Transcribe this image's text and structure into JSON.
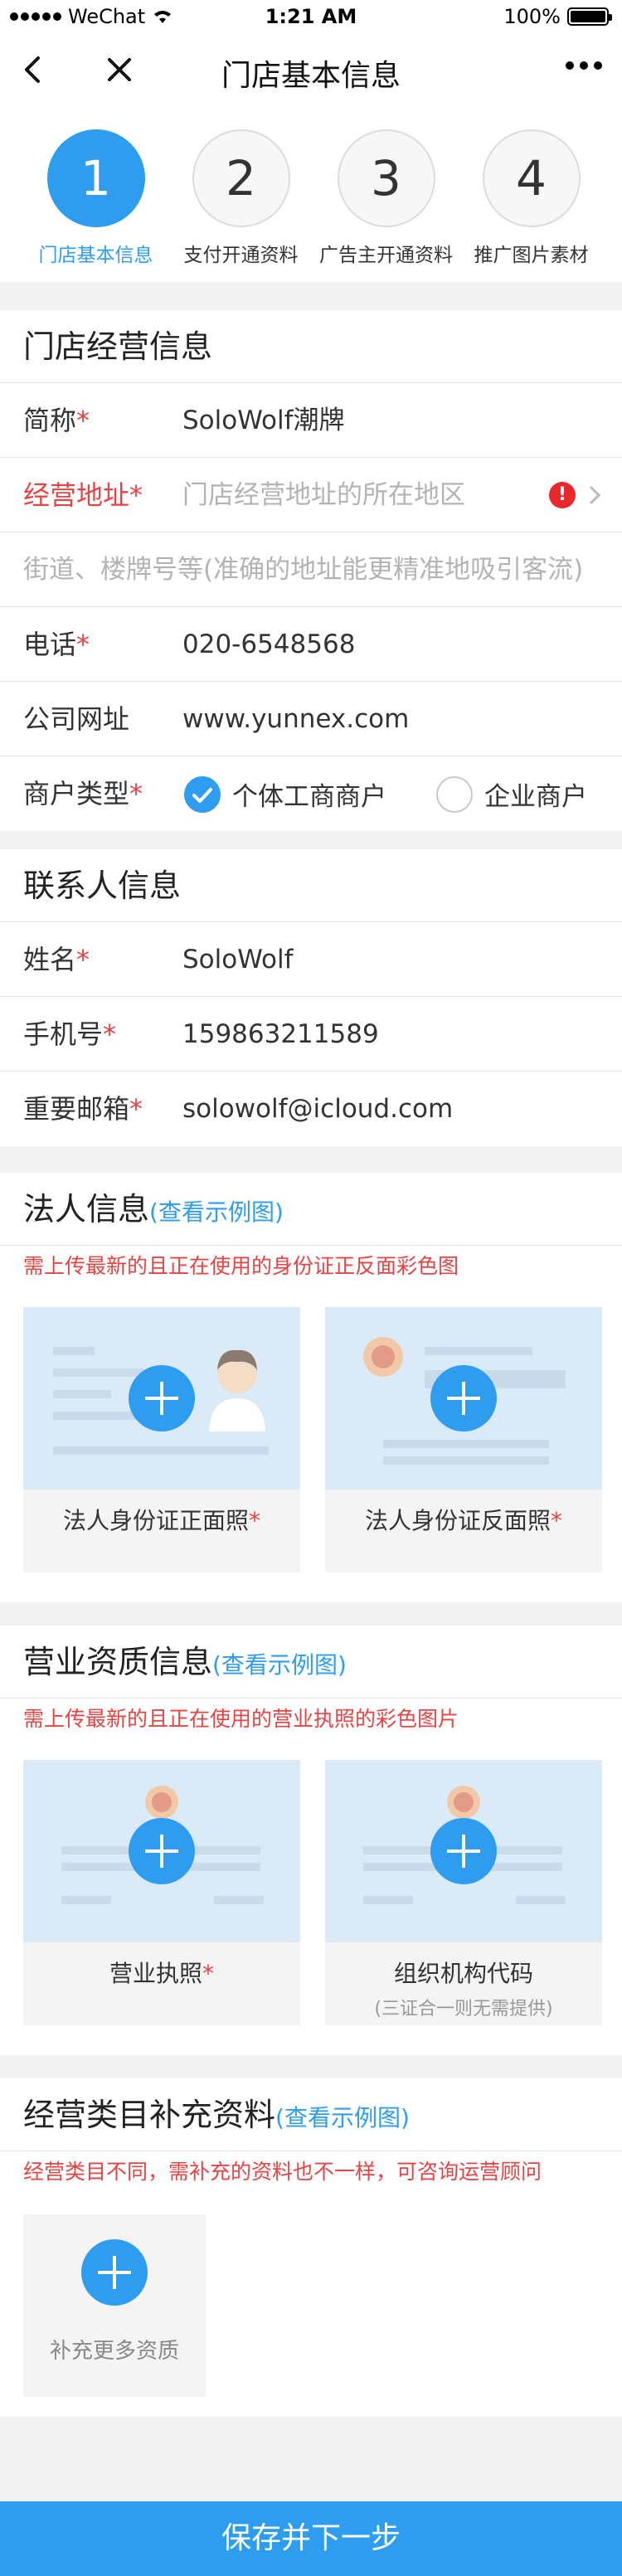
{
  "status_bar": {
    "carrier": "WeChat",
    "time": "1:21 AM",
    "battery": "100%"
  },
  "nav": {
    "title": "门店基本信息"
  },
  "steps": [
    {
      "num": "1",
      "label": "门店基本信息"
    },
    {
      "num": "2",
      "label": "支付开通资料"
    },
    {
      "num": "3",
      "label": "广告主开通资料"
    },
    {
      "num": "4",
      "label": "推广图片素材"
    }
  ],
  "store": {
    "header": "门店经营信息",
    "short_name_label": "简称",
    "short_name_value": "SoloWolf潮牌",
    "address_label": "经营地址",
    "address_placeholder": "门店经营地址的所在地区",
    "address_error_mark": "!",
    "street_placeholder": "街道、楼牌号等(准确的地址能更精准地吸引客流)",
    "phone_label": "电话",
    "phone_value": "020-6548568",
    "website_label": "公司网址",
    "website_value": "www.yunnex.com",
    "merchant_type_label": "商户类型",
    "merchant_type_option1": "个体工商商户",
    "merchant_type_option2": "企业商户"
  },
  "contact": {
    "header": "联系人信息",
    "name_label": "姓名",
    "name_value": "SoloWolf",
    "mobile_label": "手机号",
    "mobile_value": "159863211589",
    "email_label": "重要邮箱",
    "email_value": "solowolf@icloud.com"
  },
  "legal": {
    "header": "法人信息",
    "example_link": "(查看示例图)",
    "hint": "需上传最新的且正在使用的身份证正反面彩色图",
    "front_label": "法人身份证正面照",
    "back_label": "法人身份证反面照"
  },
  "business": {
    "header": "营业资质信息",
    "example_link": "(查看示例图)",
    "hint": "需上传最新的且正在使用的营业执照的彩色图片",
    "license_label": "营业执照",
    "org_label": "组织机构代码",
    "org_sub": "(三证合一则无需提供)"
  },
  "category": {
    "header": "经营类目补充资料",
    "example_link": "(查看示例图)",
    "hint": "经营类目不同，需补充的资料也不一样，可咨询运营顾问",
    "add_label": "补充更多资质"
  },
  "required_mark": "*",
  "footer": {
    "submit_label": "保存并下一步"
  },
  "colors": {
    "accent": "#2e9cef",
    "error": "#e84343"
  }
}
